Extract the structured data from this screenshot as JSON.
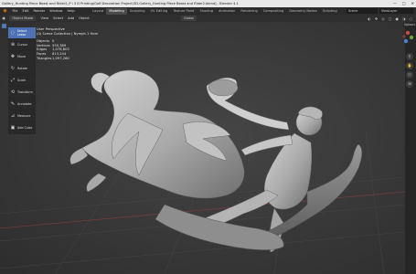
{
  "window": {
    "title": "Gallery_Hunting Piece Beast and Rider2_P i 3 D Printing\\Golf Decoration Project\\3D-Gallery_Hunting Piece Beast and Rider2.blend] - Blender 4.1",
    "controls": [
      "—",
      "□",
      "✕"
    ]
  },
  "menubar": {
    "items": [
      "File",
      "Edit",
      "Render",
      "Window",
      "Help"
    ],
    "workspaces": [
      "Layout",
      "Modeling",
      "Sculpting",
      "UV Editing",
      "Texture Paint",
      "Shading",
      "Animation",
      "Rendering",
      "Compositing",
      "Geometry Nodes",
      "Scripting"
    ],
    "active_workspace": "Modeling",
    "scene": "Scene",
    "view_layer": "ViewLayer"
  },
  "header": {
    "mode": "Object Mode",
    "items": [
      "View",
      "Select",
      "Add",
      "Object"
    ],
    "transform": "Global"
  },
  "tools": [
    {
      "label": "Select Lasso",
      "icon": "lasso-icon",
      "active": true
    },
    {
      "label": "Cursor",
      "icon": "cursor-icon",
      "active": false
    },
    {
      "label": "Move",
      "icon": "move-icon",
      "active": false
    },
    {
      "label": "Rotate",
      "icon": "rotate-icon",
      "active": false
    },
    {
      "label": "Scale",
      "icon": "scale-icon",
      "active": false
    },
    {
      "label": "Transform",
      "icon": "transform-icon",
      "active": false
    },
    {
      "label": "Annotate",
      "icon": "annotate-icon",
      "active": false
    },
    {
      "label": "Measure",
      "icon": "measure-icon",
      "active": false
    },
    {
      "label": "Add Cube",
      "icon": "add-cube-icon",
      "active": false
    }
  ],
  "viewport": {
    "view_name": "User Perspective",
    "collection": "(0) Scene Collection | Nymph 1 Horn",
    "stats": [
      {
        "key": "Objects",
        "value": "0"
      },
      {
        "key": "Vertices",
        "value": "555,389"
      },
      {
        "key": "Edges",
        "value": "1,078,803"
      },
      {
        "key": "Faces",
        "value": "613,244"
      },
      {
        "key": "Triangles",
        "value": "1,097,260"
      }
    ]
  },
  "sidebar": {
    "options_label": "Options"
  },
  "colors": {
    "accent": "#4d72b5",
    "viewport_bg": "#3a3a3a",
    "model": "#b8b8b8",
    "blender_orange": "#e87d0d"
  }
}
